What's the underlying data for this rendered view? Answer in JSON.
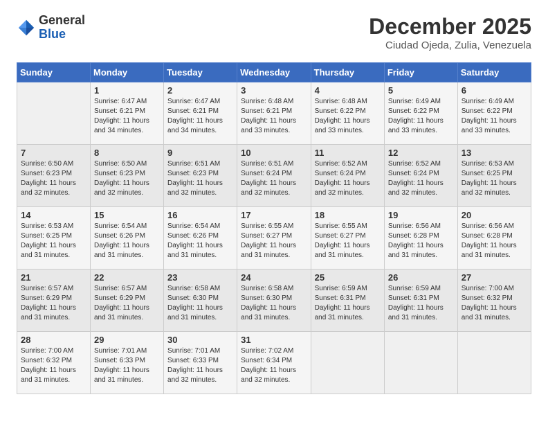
{
  "header": {
    "logo_general": "General",
    "logo_blue": "Blue",
    "main_title": "December 2025",
    "subtitle": "Ciudad Ojeda, Zulia, Venezuela"
  },
  "calendar": {
    "days_of_week": [
      "Sunday",
      "Monday",
      "Tuesday",
      "Wednesday",
      "Thursday",
      "Friday",
      "Saturday"
    ],
    "weeks": [
      [
        {
          "day": "",
          "sunrise": "",
          "sunset": "",
          "daylight": ""
        },
        {
          "day": "1",
          "sunrise": "Sunrise: 6:47 AM",
          "sunset": "Sunset: 6:21 PM",
          "daylight": "Daylight: 11 hours and 34 minutes."
        },
        {
          "day": "2",
          "sunrise": "Sunrise: 6:47 AM",
          "sunset": "Sunset: 6:21 PM",
          "daylight": "Daylight: 11 hours and 34 minutes."
        },
        {
          "day": "3",
          "sunrise": "Sunrise: 6:48 AM",
          "sunset": "Sunset: 6:21 PM",
          "daylight": "Daylight: 11 hours and 33 minutes."
        },
        {
          "day": "4",
          "sunrise": "Sunrise: 6:48 AM",
          "sunset": "Sunset: 6:22 PM",
          "daylight": "Daylight: 11 hours and 33 minutes."
        },
        {
          "day": "5",
          "sunrise": "Sunrise: 6:49 AM",
          "sunset": "Sunset: 6:22 PM",
          "daylight": "Daylight: 11 hours and 33 minutes."
        },
        {
          "day": "6",
          "sunrise": "Sunrise: 6:49 AM",
          "sunset": "Sunset: 6:22 PM",
          "daylight": "Daylight: 11 hours and 33 minutes."
        }
      ],
      [
        {
          "day": "7",
          "sunrise": "Sunrise: 6:50 AM",
          "sunset": "Sunset: 6:23 PM",
          "daylight": "Daylight: 11 hours and 32 minutes."
        },
        {
          "day": "8",
          "sunrise": "Sunrise: 6:50 AM",
          "sunset": "Sunset: 6:23 PM",
          "daylight": "Daylight: 11 hours and 32 minutes."
        },
        {
          "day": "9",
          "sunrise": "Sunrise: 6:51 AM",
          "sunset": "Sunset: 6:23 PM",
          "daylight": "Daylight: 11 hours and 32 minutes."
        },
        {
          "day": "10",
          "sunrise": "Sunrise: 6:51 AM",
          "sunset": "Sunset: 6:24 PM",
          "daylight": "Daylight: 11 hours and 32 minutes."
        },
        {
          "day": "11",
          "sunrise": "Sunrise: 6:52 AM",
          "sunset": "Sunset: 6:24 PM",
          "daylight": "Daylight: 11 hours and 32 minutes."
        },
        {
          "day": "12",
          "sunrise": "Sunrise: 6:52 AM",
          "sunset": "Sunset: 6:24 PM",
          "daylight": "Daylight: 11 hours and 32 minutes."
        },
        {
          "day": "13",
          "sunrise": "Sunrise: 6:53 AM",
          "sunset": "Sunset: 6:25 PM",
          "daylight": "Daylight: 11 hours and 32 minutes."
        }
      ],
      [
        {
          "day": "14",
          "sunrise": "Sunrise: 6:53 AM",
          "sunset": "Sunset: 6:25 PM",
          "daylight": "Daylight: 11 hours and 31 minutes."
        },
        {
          "day": "15",
          "sunrise": "Sunrise: 6:54 AM",
          "sunset": "Sunset: 6:26 PM",
          "daylight": "Daylight: 11 hours and 31 minutes."
        },
        {
          "day": "16",
          "sunrise": "Sunrise: 6:54 AM",
          "sunset": "Sunset: 6:26 PM",
          "daylight": "Daylight: 11 hours and 31 minutes."
        },
        {
          "day": "17",
          "sunrise": "Sunrise: 6:55 AM",
          "sunset": "Sunset: 6:27 PM",
          "daylight": "Daylight: 11 hours and 31 minutes."
        },
        {
          "day": "18",
          "sunrise": "Sunrise: 6:55 AM",
          "sunset": "Sunset: 6:27 PM",
          "daylight": "Daylight: 11 hours and 31 minutes."
        },
        {
          "day": "19",
          "sunrise": "Sunrise: 6:56 AM",
          "sunset": "Sunset: 6:28 PM",
          "daylight": "Daylight: 11 hours and 31 minutes."
        },
        {
          "day": "20",
          "sunrise": "Sunrise: 6:56 AM",
          "sunset": "Sunset: 6:28 PM",
          "daylight": "Daylight: 11 hours and 31 minutes."
        }
      ],
      [
        {
          "day": "21",
          "sunrise": "Sunrise: 6:57 AM",
          "sunset": "Sunset: 6:29 PM",
          "daylight": "Daylight: 11 hours and 31 minutes."
        },
        {
          "day": "22",
          "sunrise": "Sunrise: 6:57 AM",
          "sunset": "Sunset: 6:29 PM",
          "daylight": "Daylight: 11 hours and 31 minutes."
        },
        {
          "day": "23",
          "sunrise": "Sunrise: 6:58 AM",
          "sunset": "Sunset: 6:30 PM",
          "daylight": "Daylight: 11 hours and 31 minutes."
        },
        {
          "day": "24",
          "sunrise": "Sunrise: 6:58 AM",
          "sunset": "Sunset: 6:30 PM",
          "daylight": "Daylight: 11 hours and 31 minutes."
        },
        {
          "day": "25",
          "sunrise": "Sunrise: 6:59 AM",
          "sunset": "Sunset: 6:31 PM",
          "daylight": "Daylight: 11 hours and 31 minutes."
        },
        {
          "day": "26",
          "sunrise": "Sunrise: 6:59 AM",
          "sunset": "Sunset: 6:31 PM",
          "daylight": "Daylight: 11 hours and 31 minutes."
        },
        {
          "day": "27",
          "sunrise": "Sunrise: 7:00 AM",
          "sunset": "Sunset: 6:32 PM",
          "daylight": "Daylight: 11 hours and 31 minutes."
        }
      ],
      [
        {
          "day": "28",
          "sunrise": "Sunrise: 7:00 AM",
          "sunset": "Sunset: 6:32 PM",
          "daylight": "Daylight: 11 hours and 31 minutes."
        },
        {
          "day": "29",
          "sunrise": "Sunrise: 7:01 AM",
          "sunset": "Sunset: 6:33 PM",
          "daylight": "Daylight: 11 hours and 31 minutes."
        },
        {
          "day": "30",
          "sunrise": "Sunrise: 7:01 AM",
          "sunset": "Sunset: 6:33 PM",
          "daylight": "Daylight: 11 hours and 32 minutes."
        },
        {
          "day": "31",
          "sunrise": "Sunrise: 7:02 AM",
          "sunset": "Sunset: 6:34 PM",
          "daylight": "Daylight: 11 hours and 32 minutes."
        },
        {
          "day": "",
          "sunrise": "",
          "sunset": "",
          "daylight": ""
        },
        {
          "day": "",
          "sunrise": "",
          "sunset": "",
          "daylight": ""
        },
        {
          "day": "",
          "sunrise": "",
          "sunset": "",
          "daylight": ""
        }
      ]
    ]
  }
}
